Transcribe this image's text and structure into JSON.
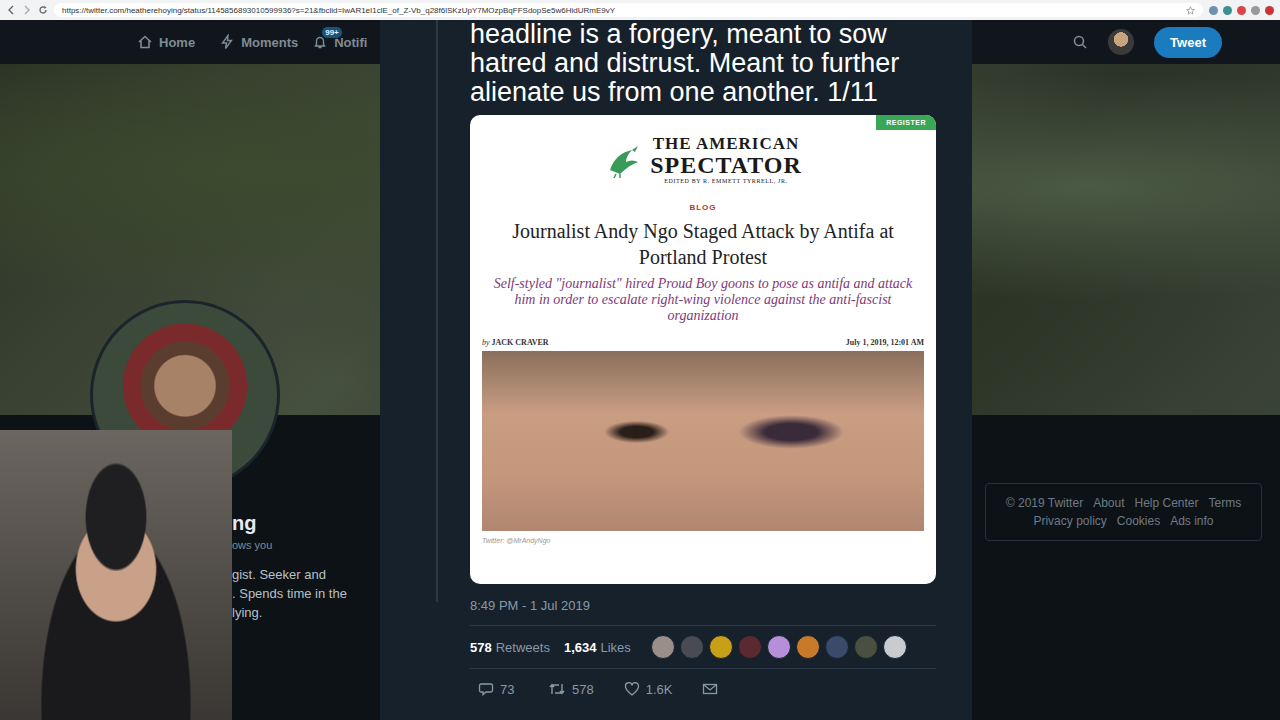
{
  "browser": {
    "url": "https://twitter.com/heatherehoying/status/1145856893010599936?s=21&fbclid=IwAR1eI1clE_of_Z-Vb_q28f6lSKzUpY7MOzpBqFFSdopSe5w6HidURmE9vY"
  },
  "nav": {
    "home": "Home",
    "moments": "Moments",
    "notifications": "Notifi",
    "badge": "99+",
    "tweet_button": "Tweet"
  },
  "profile": {
    "name": "ng",
    "follows": "ows you",
    "bio": [
      "gist. Seeker and",
      ". Spends time in the",
      "lying."
    ]
  },
  "footer": {
    "lines": [
      [
        "© 2019 Twitter",
        "About",
        "Help Center",
        "Terms"
      ],
      [
        "Privacy policy",
        "Cookies",
        "Ads info"
      ]
    ]
  },
  "tweet": {
    "text": "headline is a forgery, meant to sow hatred and distrust. Meant to further alienate us from one another. 1/11",
    "article": {
      "register": "REGISTER",
      "logo_top": "THE AMERICAN",
      "logo_main": "SPECTATOR",
      "logo_edited": "EDITED BY R. EMMETT TYRRELL, JR.",
      "section": "BLOG",
      "headline": "Journalist Andy Ngo Staged Attack by Antifa at Portland Protest",
      "dek": "Self-styled \"journalist\" hired Proud Boy goons to pose as antifa and attack him in order to escalate right-wing violence against the anti-fascist organization",
      "byline_prefix": "by",
      "author": "JACK CRAVER",
      "date": "July 1, 2019, 12:01 AM",
      "credit": "Twitter: @MrAndyNgo"
    },
    "time": "8:49 PM - 1 Jul 2019",
    "stats": [
      {
        "count": "578",
        "label": "Retweets"
      },
      {
        "count": "1,634",
        "label": "Likes"
      }
    ],
    "likers": [
      {
        "color": "#9a8f88"
      },
      {
        "color": "#4a4a52"
      },
      {
        "color": "#c8a018"
      },
      {
        "color": "#5a2a30"
      },
      {
        "color": "#b58fd8"
      },
      {
        "color": "#c87a2a"
      },
      {
        "color": "#3a4a6a"
      },
      {
        "color": "#4a5040"
      },
      {
        "color": "#c8ccd0"
      }
    ],
    "replies": "73",
    "retweets": "578",
    "likes": "1.6K"
  }
}
